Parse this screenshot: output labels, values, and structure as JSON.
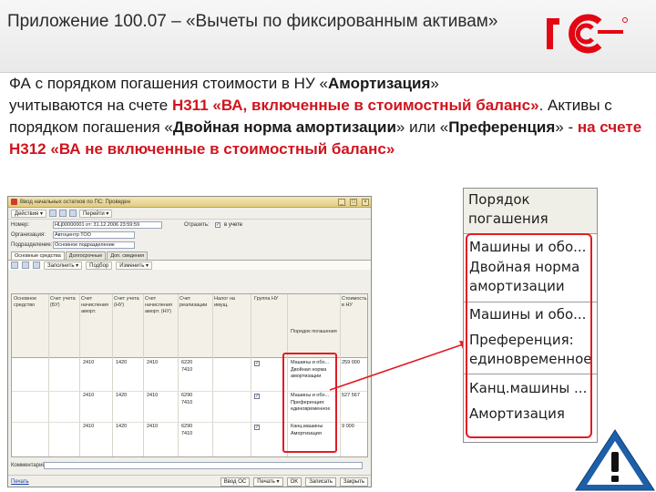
{
  "header": {
    "title": "Приложение 100.07 – «Вычеты по фиксированным активам»",
    "logo_text": "1С"
  },
  "body": {
    "p1_a": "ФА с порядком погашения стоимости в  НУ «",
    "p1_b": "Амортизация",
    "p1_c": "»",
    "p2_a": "учитываются на счете ",
    "p2_red": "Н311 «ВА, включенные в стоимостный баланс»",
    "p3_a": ". Активы с порядком погашения «",
    "p3_b": "Двойная норма амортизации",
    "p3_c": "» или «",
    "p3_d": "Преференция",
    "p3_e": "» - ",
    "p3_red": "на счете Н312 «ВА не включенные в стоимостный баланс»"
  },
  "window": {
    "title": "Ввод начальных остатков по ПС: Проведен",
    "toolbar": [
      "Действия ▾",
      "Перейти ▾"
    ],
    "nomer_label": "Номер:",
    "nomer_value": "НЦ00000001 от: 31.12.2006 23:59:59",
    "org_label": "Организация:",
    "org_value": "Автоцентр ТОО",
    "podr_label": "Подразделение:",
    "podr_value": "Основное подразделение",
    "reflect_label": "Отразить:",
    "reflect_option": "в учете",
    "tabs": [
      "Основные средства",
      "Долгосрочные",
      "Доп. сведения"
    ],
    "grid_toolbar": [
      "Заполнить ▾",
      "Подбор",
      "Изменить ▾"
    ],
    "columns": [
      "Основное средство",
      "Счет учета (БУ)",
      "Счет начисления аморт.",
      "Счет учета (НУ)",
      "Счет начисления аморт. (НУ)",
      "Счет реализации",
      "Налог на имущ.",
      "Группа НУ",
      "Порядок погашения",
      "Стоимость в НУ"
    ],
    "rows": [
      {
        "bu": "2410",
        "am": "1420",
        "nu": "2410",
        "nam": "6220",
        "real": "7410",
        "cost": "259 000",
        "order1": "Машины и обо...",
        "order2": "Двойная норма амортизации"
      },
      {
        "bu": "2410",
        "am": "1420",
        "nu": "2410",
        "nam": "6290",
        "real": "7410",
        "cost": "527 567",
        "order1": "Машины и обо...",
        "order2": "Преференция: единовременное"
      },
      {
        "bu": "2410",
        "am": "1420",
        "nu": "2410",
        "nam": "6290",
        "real": "7410",
        "cost": "9 000",
        "order1": "Канц.машины",
        "order2": "Амортизация"
      }
    ],
    "comment_label": "Комментарий:",
    "bottom_link": "Печать",
    "bottom_buttons": [
      "Ввод ОС",
      "Печать ▾",
      "OK",
      "Записать",
      "Закрыть"
    ]
  },
  "zoom": {
    "header": "Порядок погашения",
    "items": [
      "Машины и обо...",
      "Двойная норма амортизации",
      "Машины и обо...",
      "Преференция: единовременное",
      "Канц.машины ...",
      "Амортизация"
    ]
  },
  "colors": {
    "accent_red": "#e31b23",
    "text_red": "#d0141e",
    "logo_red": "#e30613",
    "warning_blue": "#1d5fa8"
  }
}
